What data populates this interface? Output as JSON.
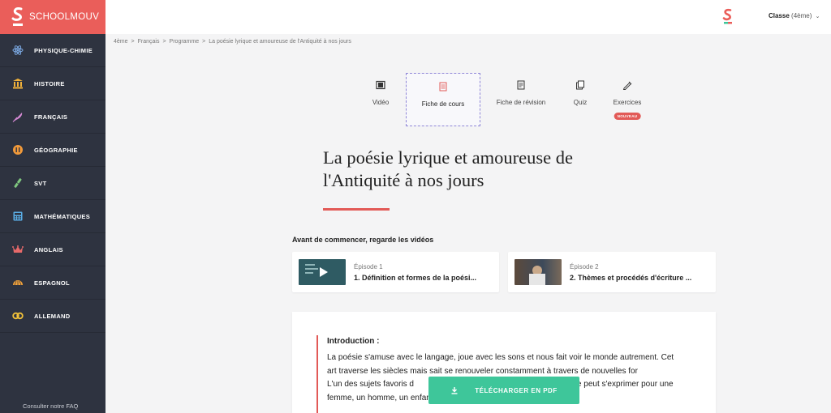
{
  "brand": {
    "name": "SCHOOLMOUV"
  },
  "sidebar": {
    "items": [
      {
        "label": "PHYSIQUE-CHIMIE",
        "icon": "atom-icon"
      },
      {
        "label": "HISTOIRE",
        "icon": "temple-icon"
      },
      {
        "label": "FRANÇAIS",
        "icon": "feather-icon"
      },
      {
        "label": "GÉOGRAPHIE",
        "icon": "compass-icon"
      },
      {
        "label": "SVT",
        "icon": "dna-icon"
      },
      {
        "label": "MATHÉMATIQUES",
        "icon": "calculator-icon"
      },
      {
        "label": "ANGLAIS",
        "icon": "crown-icon"
      },
      {
        "label": "ESPAGNOL",
        "icon": "fan-icon"
      },
      {
        "label": "ALLEMAND",
        "icon": "pretzel-icon"
      }
    ],
    "faq": "Consulter notre FAQ"
  },
  "header": {
    "class_label": "Classe",
    "class_value": "(4ème)"
  },
  "breadcrumb": [
    "4ème",
    "Français",
    "Programme",
    "La poésie lyrique et amoureuse de l'Antiquité à nos jours"
  ],
  "tabs": [
    {
      "label": "Vidéo",
      "icon": "film-icon"
    },
    {
      "label": "Fiche de cours",
      "icon": "document-icon",
      "active": true
    },
    {
      "label": "Fiche de révision",
      "icon": "note-icon"
    },
    {
      "label": "Quiz",
      "icon": "cards-icon"
    },
    {
      "label": "Exercices",
      "icon": "pen-icon",
      "badge": "NOUVEAU"
    }
  ],
  "page": {
    "title_line1": "La poésie lyrique et amoureuse de",
    "title_line2": "l'Antiquité à nos jours"
  },
  "videos": {
    "label": "Avant de commencer, regarde les vidéos",
    "items": [
      {
        "episode": "Épisode 1",
        "title": "1. Définition et formes de la poési..."
      },
      {
        "episode": "Épisode 2",
        "title": "2. Thèmes et procédés d'écriture ..."
      }
    ]
  },
  "content": {
    "intro_heading": "Introduction :",
    "p1": "La poésie s'amuse avec le langage, joue avec les sons et nous fait voir le monde autrement. Cet art traverse les siècles mais sait se renouveler constamment à travers de nouvelles for",
    "p2": "L'un des sujets favoris d",
    "p2_tail": "reux. L'amour du poète peut s'exprimer pour une femme, un homme, un enfant, un paysage, une ville, ou"
  },
  "pdf_button": {
    "label": "TÉLÉCHARGER EN PDF"
  },
  "colors": {
    "brand": "#ea5e5a",
    "sidebar": "#2e3340",
    "accent": "#e25a57",
    "pdf": "#3ec69a"
  }
}
